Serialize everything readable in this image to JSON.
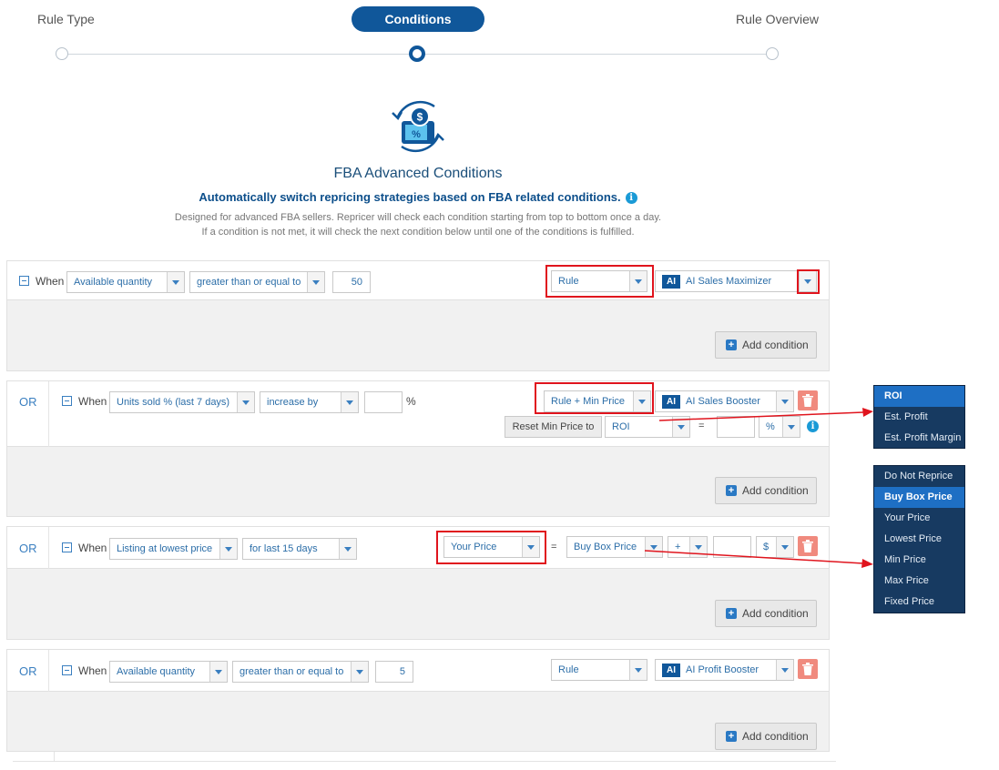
{
  "stepper": {
    "steps": [
      "Rule Type",
      "Conditions",
      "Rule Overview"
    ],
    "active_step": "Conditions"
  },
  "header": {
    "title": "FBA Advanced Conditions",
    "subtitle": "Automatically switch repricing strategies based on FBA related conditions.",
    "info_glyph": "i",
    "description_line1": "Designed for advanced FBA sellers. Repricer will check each condition starting from top to bottom once a day.",
    "description_line2": "If a condition is not met, it will check the next condition below until one of the conditions is fulfilled."
  },
  "labels": {
    "or": "OR",
    "when": "When",
    "add_condition": "Add condition",
    "ai_tag": "AI",
    "equals": "=",
    "percent": "%",
    "plus_glyph": "+",
    "reset_min_price": "Reset Min Price to"
  },
  "conditions": [
    {
      "metric": "Available quantity",
      "operator": "greater than or equal to",
      "value": "50",
      "action": "Rule",
      "strategy": "AI Sales Maximizer"
    },
    {
      "metric": "Units sold % (last 7 days)",
      "operator": "increase by",
      "value": "",
      "action": "Rule + Min Price",
      "strategy": "AI Sales Booster",
      "reset_basis": "ROI",
      "reset_value": "",
      "reset_unit": "%"
    },
    {
      "metric": "Listing at lowest price",
      "operator": "for last 15 days",
      "action": "Your Price",
      "target": "Buy Box Price",
      "modifier": "+",
      "value": "",
      "unit": "$"
    },
    {
      "metric": "Available quantity",
      "operator": "greater than or equal to",
      "value": "5",
      "action": "Rule",
      "strategy": "AI Profit Booster"
    }
  ],
  "dropdown_roi": {
    "options": [
      "ROI",
      "Est. Profit",
      "Est. Profit Margin"
    ],
    "selected": "ROI"
  },
  "dropdown_price": {
    "options": [
      "Do Not Reprice",
      "Buy Box Price",
      "Your Price",
      "Lowest Price",
      "Min Price",
      "Max Price",
      "Fixed Price"
    ],
    "selected": "Buy Box Price"
  },
  "colors": {
    "brand": "#10579a",
    "highlight": "#e0141d",
    "delete": "#f08a7e",
    "dropdown_bg": "#173a61",
    "dropdown_selected": "#1e6fc4"
  },
  "icons": [
    "repricing-cycle-icon",
    "collapse-icon",
    "chevron-down-icon",
    "trash-icon",
    "plus-icon",
    "info-icon"
  ]
}
